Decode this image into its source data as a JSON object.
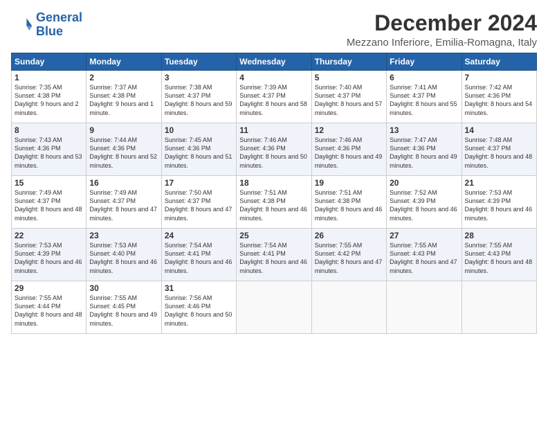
{
  "logo": {
    "line1": "General",
    "line2": "Blue"
  },
  "title": "December 2024",
  "location": "Mezzano Inferiore, Emilia-Romagna, Italy",
  "days_of_week": [
    "Sunday",
    "Monday",
    "Tuesday",
    "Wednesday",
    "Thursday",
    "Friday",
    "Saturday"
  ],
  "weeks": [
    [
      {
        "day": 1,
        "sunrise": "7:35 AM",
        "sunset": "4:38 PM",
        "daylight": "9 hours and 2 minutes."
      },
      {
        "day": 2,
        "sunrise": "7:37 AM",
        "sunset": "4:38 PM",
        "daylight": "9 hours and 1 minute."
      },
      {
        "day": 3,
        "sunrise": "7:38 AM",
        "sunset": "4:37 PM",
        "daylight": "8 hours and 59 minutes."
      },
      {
        "day": 4,
        "sunrise": "7:39 AM",
        "sunset": "4:37 PM",
        "daylight": "8 hours and 58 minutes."
      },
      {
        "day": 5,
        "sunrise": "7:40 AM",
        "sunset": "4:37 PM",
        "daylight": "8 hours and 57 minutes."
      },
      {
        "day": 6,
        "sunrise": "7:41 AM",
        "sunset": "4:37 PM",
        "daylight": "8 hours and 55 minutes."
      },
      {
        "day": 7,
        "sunrise": "7:42 AM",
        "sunset": "4:36 PM",
        "daylight": "8 hours and 54 minutes."
      }
    ],
    [
      {
        "day": 8,
        "sunrise": "7:43 AM",
        "sunset": "4:36 PM",
        "daylight": "8 hours and 53 minutes."
      },
      {
        "day": 9,
        "sunrise": "7:44 AM",
        "sunset": "4:36 PM",
        "daylight": "8 hours and 52 minutes."
      },
      {
        "day": 10,
        "sunrise": "7:45 AM",
        "sunset": "4:36 PM",
        "daylight": "8 hours and 51 minutes."
      },
      {
        "day": 11,
        "sunrise": "7:46 AM",
        "sunset": "4:36 PM",
        "daylight": "8 hours and 50 minutes."
      },
      {
        "day": 12,
        "sunrise": "7:46 AM",
        "sunset": "4:36 PM",
        "daylight": "8 hours and 49 minutes."
      },
      {
        "day": 13,
        "sunrise": "7:47 AM",
        "sunset": "4:36 PM",
        "daylight": "8 hours and 49 minutes."
      },
      {
        "day": 14,
        "sunrise": "7:48 AM",
        "sunset": "4:37 PM",
        "daylight": "8 hours and 48 minutes."
      }
    ],
    [
      {
        "day": 15,
        "sunrise": "7:49 AM",
        "sunset": "4:37 PM",
        "daylight": "8 hours and 48 minutes."
      },
      {
        "day": 16,
        "sunrise": "7:49 AM",
        "sunset": "4:37 PM",
        "daylight": "8 hours and 47 minutes."
      },
      {
        "day": 17,
        "sunrise": "7:50 AM",
        "sunset": "4:37 PM",
        "daylight": "8 hours and 47 minutes."
      },
      {
        "day": 18,
        "sunrise": "7:51 AM",
        "sunset": "4:38 PM",
        "daylight": "8 hours and 46 minutes."
      },
      {
        "day": 19,
        "sunrise": "7:51 AM",
        "sunset": "4:38 PM",
        "daylight": "8 hours and 46 minutes."
      },
      {
        "day": 20,
        "sunrise": "7:52 AM",
        "sunset": "4:39 PM",
        "daylight": "8 hours and 46 minutes."
      },
      {
        "day": 21,
        "sunrise": "7:53 AM",
        "sunset": "4:39 PM",
        "daylight": "8 hours and 46 minutes."
      }
    ],
    [
      {
        "day": 22,
        "sunrise": "7:53 AM",
        "sunset": "4:39 PM",
        "daylight": "8 hours and 46 minutes."
      },
      {
        "day": 23,
        "sunrise": "7:53 AM",
        "sunset": "4:40 PM",
        "daylight": "8 hours and 46 minutes."
      },
      {
        "day": 24,
        "sunrise": "7:54 AM",
        "sunset": "4:41 PM",
        "daylight": "8 hours and 46 minutes."
      },
      {
        "day": 25,
        "sunrise": "7:54 AM",
        "sunset": "4:41 PM",
        "daylight": "8 hours and 46 minutes."
      },
      {
        "day": 26,
        "sunrise": "7:55 AM",
        "sunset": "4:42 PM",
        "daylight": "8 hours and 47 minutes."
      },
      {
        "day": 27,
        "sunrise": "7:55 AM",
        "sunset": "4:43 PM",
        "daylight": "8 hours and 47 minutes."
      },
      {
        "day": 28,
        "sunrise": "7:55 AM",
        "sunset": "4:43 PM",
        "daylight": "8 hours and 48 minutes."
      }
    ],
    [
      {
        "day": 29,
        "sunrise": "7:55 AM",
        "sunset": "4:44 PM",
        "daylight": "8 hours and 48 minutes."
      },
      {
        "day": 30,
        "sunrise": "7:55 AM",
        "sunset": "4:45 PM",
        "daylight": "8 hours and 49 minutes."
      },
      {
        "day": 31,
        "sunrise": "7:56 AM",
        "sunset": "4:46 PM",
        "daylight": "8 hours and 50 minutes."
      },
      null,
      null,
      null,
      null
    ]
  ]
}
